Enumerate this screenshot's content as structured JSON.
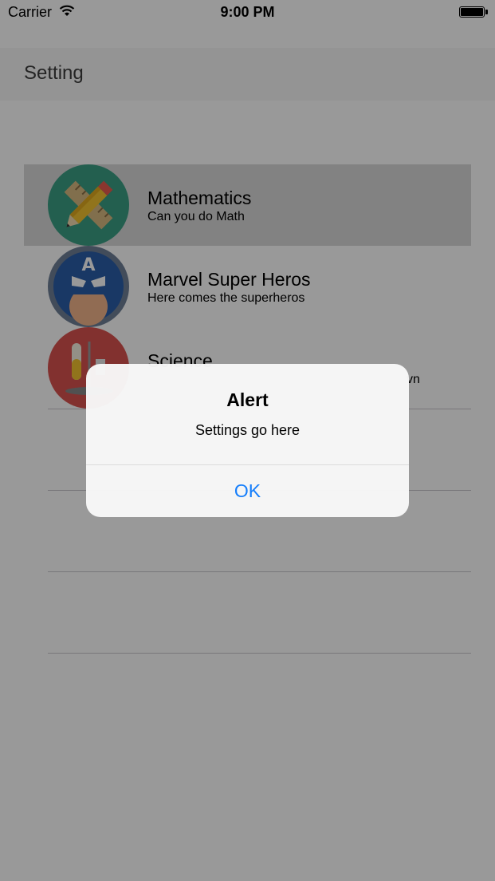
{
  "status_bar": {
    "carrier": "Carrier",
    "time": "9:00 PM",
    "wifi_icon": "wifi-icon",
    "battery_icon": "battery-icon"
  },
  "nav": {
    "title": "Setting"
  },
  "rows": [
    {
      "title": "Mathematics",
      "subtitle": "Can you do Math",
      "icon": "math-pencil-ruler-icon",
      "selected": true
    },
    {
      "title": "Marvel Super Heros",
      "subtitle": "Here comes the superheros",
      "icon": "captain-america-icon"
    },
    {
      "title": "Science",
      "subtitle": "",
      "partial_text": "vn",
      "icon": "science-lab-icon"
    }
  ],
  "alert": {
    "title": "Alert",
    "message": "Settings go here",
    "ok_label": "OK"
  },
  "colors": {
    "tint": "#157efb",
    "overlay": "rgba(0,0,0,0.4)",
    "selected_row": "#d9d9d9"
  }
}
